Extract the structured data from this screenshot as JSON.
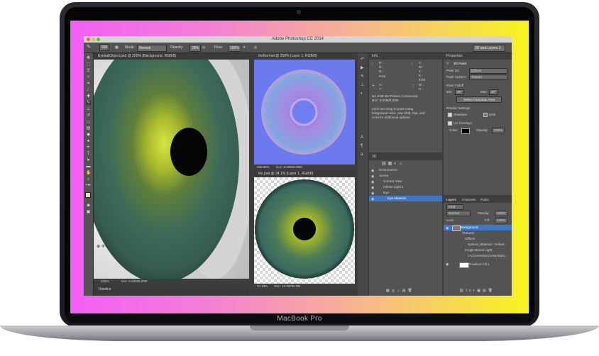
{
  "laptop": {
    "brand": "MacBook Pro"
  },
  "app": {
    "title": "Adobe Photoshop CC 2014"
  },
  "options": {
    "brush_size": "500",
    "mode_label": "Mode:",
    "mode_value": "Normal",
    "opacity_label": "Opacity:",
    "opacity_value": "28%",
    "flow_label": "Flow:",
    "flow_value": "100%",
    "workspace": "3D and Layers 2"
  },
  "documents": [
    {
      "tab": "EyeballObject.psd @ 200% (Background, RGB/8)",
      "zoom": "200%",
      "doc": "Doc: 6.00M/8.00M"
    },
    {
      "tab": "IrisNormal @ 258% (Layer 1, RGB/8)",
      "zoom": "258.68%",
      "doc": "Doc: 6.00M/6.00M"
    },
    {
      "tab": "Iris.psd @ 34.1% (Layer 1, RGB/8)",
      "zoom": "34.13%",
      "doc": "Doc: 12.0M/96.0M"
    }
  ],
  "timeline": "Timeline",
  "info_panel": {
    "tab": "Info",
    "r": "R :",
    "g": "G :",
    "b": "B :",
    "c": "C :",
    "m": "M :",
    "y": "Y :",
    "k": "K :",
    "bit_left": "8-bit",
    "bit_right": "8-bit",
    "x": "X :",
    "y2": "Y :",
    "w": "W :",
    "h": "H :",
    "lines": [
      "No USB 3D Printers Connected.",
      "Doc: 6.00M/6.00M",
      "",
      "Click and drag to paint using",
      "foreground color. Use Shift, Opt, and",
      "Cmd for additional options."
    ]
  },
  "scene_panel": {
    "tab": "3D",
    "items": [
      "Environment",
      "Scene",
      "Current View",
      "Infinite Light 1",
      "Eye",
      "Eye Material"
    ]
  },
  "properties": {
    "tab": "Properties",
    "heading": "3D Paint",
    "paint_on_label": "Paint On:",
    "paint_on_value": "Diffuse",
    "paint_system_label": "Paint System:",
    "paint_system_value": "Texture",
    "falloff_label": "Paint Falloff",
    "min_label": "Min:",
    "min_value": "90°",
    "max_label": "Max:",
    "max_value": "90°",
    "select_button": "Select Paintable Area",
    "render_label": "Render Settings",
    "shadows_label": "Shadows",
    "unlit_label": "Unlit",
    "uv_label": "UV Overlays",
    "color_label": "Color:",
    "opacity_label": "Opacity:",
    "opacity_value": "100%"
  },
  "layers_panel": {
    "tabs": [
      "Layers",
      "Channels",
      "Paths"
    ],
    "kind": "Kind",
    "blend": "Normal",
    "opacity_label": "Opacity:",
    "opacity_value": "100%",
    "lock_label": "Lock:",
    "fill_label": "Fill:",
    "fill_value": "100%",
    "rows": [
      "Background",
      "Textures",
      "Diffuse",
      "Sphere_Material - Defaul...",
      "Image Based Light",
      "LAConventionCenterEast...",
      "Gradient Fill 1"
    ]
  }
}
